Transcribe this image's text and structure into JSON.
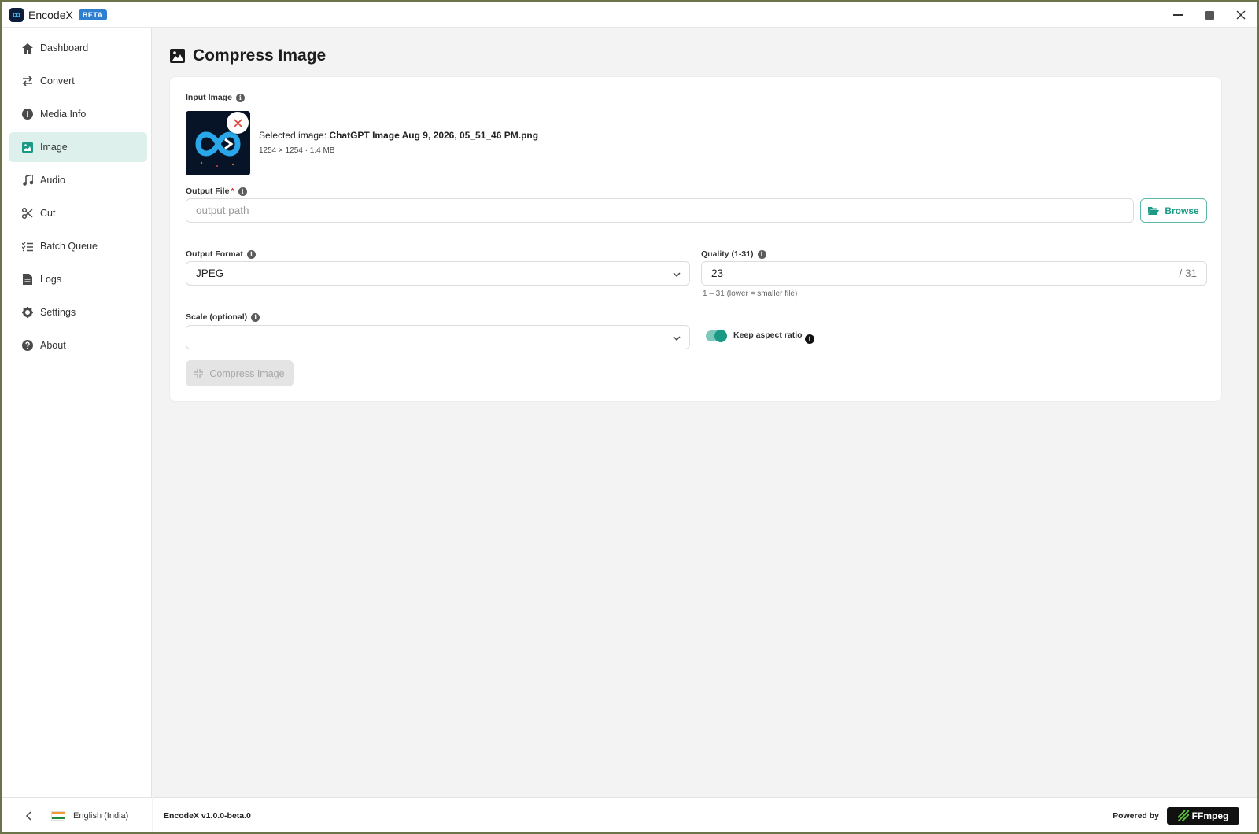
{
  "app": {
    "title": "EncodeX",
    "badge": "BETA"
  },
  "sidebar": {
    "items": [
      {
        "label": "Dashboard",
        "icon": "home-icon"
      },
      {
        "label": "Convert",
        "icon": "swap-icon"
      },
      {
        "label": "Media Info",
        "icon": "info-circle-icon"
      },
      {
        "label": "Image",
        "icon": "image-icon",
        "active": true
      },
      {
        "label": "Audio",
        "icon": "music-note-icon"
      },
      {
        "label": "Cut",
        "icon": "scissors-icon"
      },
      {
        "label": "Batch Queue",
        "icon": "list-check-icon"
      },
      {
        "label": "Logs",
        "icon": "file-icon"
      },
      {
        "label": "Settings",
        "icon": "gear-icon"
      },
      {
        "label": "About",
        "icon": "question-icon"
      }
    ],
    "language": "English (India)"
  },
  "page": {
    "title": "Compress Image"
  },
  "form": {
    "input_image": {
      "label": "Input Image",
      "selected_prefix": "Selected image:",
      "filename": "ChatGPT Image Aug 9, 2026, 05_51_46 PM.png",
      "details": "1254 × 1254 · 1.4 MB"
    },
    "output_file": {
      "label": "Output File",
      "required_mark": "*",
      "placeholder": "output path",
      "value": "",
      "browse_label": "Browse"
    },
    "output_format": {
      "label": "Output Format",
      "value": "JPEG"
    },
    "quality": {
      "label": "Quality (1-31)",
      "value": "23",
      "suffix": "/ 31",
      "helper": "1 – 31 (lower = smaller file)"
    },
    "scale": {
      "label": "Scale (optional)",
      "value": ""
    },
    "keep_aspect": {
      "label": "Keep aspect ratio",
      "enabled": true
    },
    "submit_label": "Compress Image"
  },
  "footer": {
    "version": "EncodeX v1.0.0-beta.0",
    "powered_by": "Powered by",
    "ffmpeg_label": "FFmpeg"
  },
  "colors": {
    "accent": "#1a9a85",
    "active_nav_bg": "#ddf0ec",
    "beta_badge": "#2f7fd1"
  }
}
